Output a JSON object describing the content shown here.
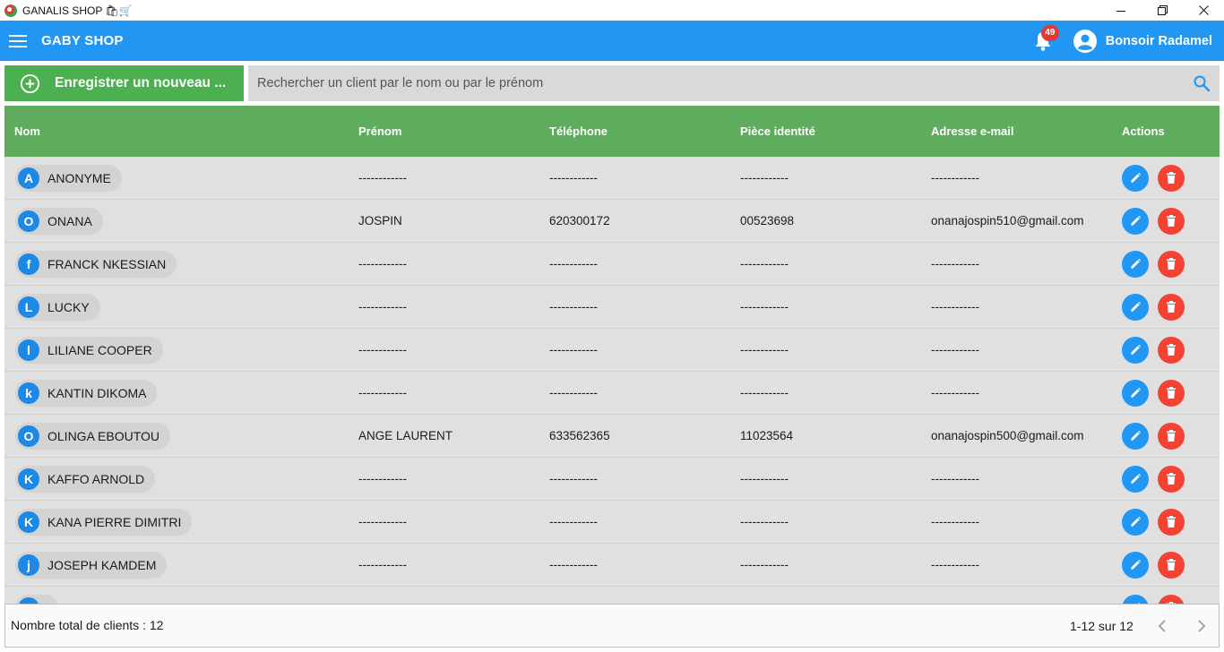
{
  "window": {
    "title": "GANALIS SHOP 🛍🛒",
    "controls": [
      "minimize",
      "maximize",
      "close"
    ]
  },
  "appbar": {
    "brand": "GABY SHOP",
    "notification_count": "49",
    "greeting": "Bonsoir Radamel",
    "color": "#2196f3"
  },
  "toolbar": {
    "new_button_label": "Enregistrer un nouveau ...",
    "search_placeholder": "Rechercher un client par le nom ou par le prénom"
  },
  "table": {
    "headers": [
      "Nom",
      "Prénom",
      "Téléphone",
      "Pièce identité",
      "Adresse e-mail",
      "Actions"
    ],
    "rows": [
      {
        "initial": "A",
        "name": "ANONYME",
        "prenom": "------------",
        "telephone": "------------",
        "piece": "------------",
        "email": "------------"
      },
      {
        "initial": "O",
        "name": "ONANA",
        "prenom": " JOSPIN",
        "telephone": "620300172",
        "piece": "00523698",
        "email": "onanajospin510@gmail.com"
      },
      {
        "initial": "f",
        "name": "FRANCK NKESSIAN",
        "prenom": "------------",
        "telephone": "------------",
        "piece": "------------",
        "email": "------------"
      },
      {
        "initial": "L",
        "name": "LUCKY",
        "prenom": "------------",
        "telephone": "------------",
        "piece": "------------",
        "email": "------------"
      },
      {
        "initial": "l",
        "name": "LILIANE COOPER",
        "prenom": "------------",
        "telephone": "------------",
        "piece": "------------",
        "email": "------------"
      },
      {
        "initial": "k",
        "name": "KANTIN DIKOMA",
        "prenom": "------------",
        "telephone": "------------",
        "piece": "------------",
        "email": "------------"
      },
      {
        "initial": "O",
        "name": "OLINGA EBOUTOU",
        "prenom": "ANGE LAURENT",
        "telephone": "633562365",
        "piece": "11023564",
        "email": "onanajospin500@gmail.com"
      },
      {
        "initial": "K",
        "name": "KAFFO ARNOLD",
        "prenom": "------------",
        "telephone": "------------",
        "piece": "------------",
        "email": "------------"
      },
      {
        "initial": "K",
        "name": "KANA PIERRE DIMITRI",
        "prenom": "------------",
        "telephone": "------------",
        "piece": "------------",
        "email": "------------"
      },
      {
        "initial": "j",
        "name": "JOSEPH KAMDEM",
        "prenom": "------------",
        "telephone": "------------",
        "piece": "------------",
        "email": "------------"
      },
      {
        "initial": "",
        "name": "",
        "prenom": "",
        "telephone": "",
        "piece": "",
        "email": ""
      }
    ]
  },
  "footer": {
    "total_label": "Nombre total de clients : 12",
    "range_label": "1-12 sur 12"
  },
  "colors": {
    "header_green": "#5dad5d",
    "new_button_green": "#4caf50",
    "edit_blue": "#2196f3",
    "delete_red": "#f44336",
    "avatar_blue": "#1e88e5"
  }
}
